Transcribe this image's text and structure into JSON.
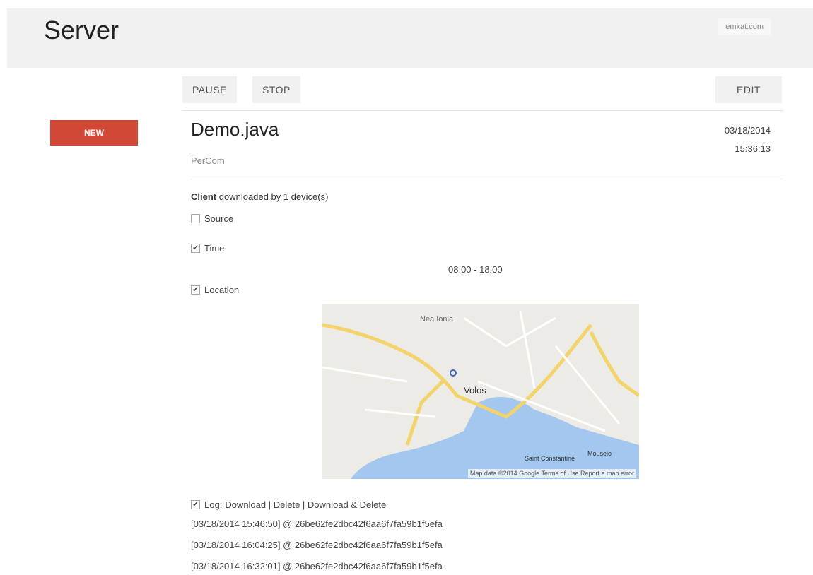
{
  "header": {
    "title": "Server",
    "user": "emkat.com"
  },
  "toolbar": {
    "pause_label": "PAUSE",
    "stop_label": "STOP",
    "edit_label": "EDIT"
  },
  "badge": {
    "label": "NEW",
    "color": "#d14836"
  },
  "job": {
    "title": "Demo.java",
    "subtitle": "PerCom",
    "date": "03/18/2014",
    "time": "15:36:13"
  },
  "client": {
    "label": "Client",
    "text": "downloaded by 1 device(s)"
  },
  "options": {
    "source": {
      "label": "Source",
      "checked": false
    },
    "time": {
      "label": "Time",
      "checked": true,
      "range": "08:00 - 18:00"
    },
    "location": {
      "label": "Location",
      "checked": true
    },
    "log": {
      "label": "Log:",
      "checked": true,
      "actions": "Download | Delete | Download & Delete"
    }
  },
  "map": {
    "labels": [
      "Nea Ionia",
      "Volos",
      "Saint Constantine",
      "Mouseio"
    ],
    "attribution": "Map data ©2014 Google   Terms of Use   Report a map error"
  },
  "log_entries": [
    "[03/18/2014 15:46:50] @ 26be62fe2dbc42f6aa6f7fa59b1f5efa",
    "[03/18/2014 16:04:25] @ 26be62fe2dbc42f6aa6f7fa59b1f5efa",
    "[03/18/2014 16:32:01] @ 26be62fe2dbc42f6aa6f7fa59b1f5efa"
  ]
}
